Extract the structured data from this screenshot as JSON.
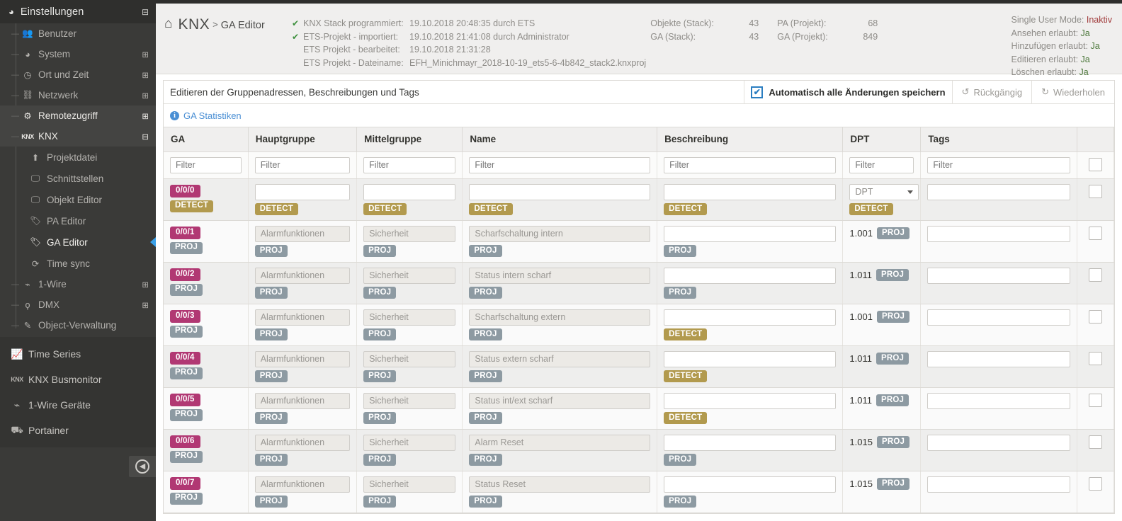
{
  "sidebar": {
    "header": {
      "title": "Einstellungen",
      "icon": "dashboard-icon",
      "collapse_icon": "minus-box-icon"
    },
    "settings_items": [
      {
        "label": "Benutzer",
        "icon": "users-icon",
        "expander": "",
        "state": "normal"
      },
      {
        "label": "System",
        "icon": "dashboard-icon",
        "expander": "plus-box-icon",
        "state": "normal"
      },
      {
        "label": "Ort und Zeit",
        "icon": "clock-icon",
        "expander": "plus-box-icon",
        "state": "normal"
      },
      {
        "label": "Netzwerk",
        "icon": "network-icon",
        "expander": "plus-box-icon",
        "state": "normal"
      },
      {
        "label": "Remotezugriff",
        "icon": "gears-icon",
        "expander": "plus-box-icon",
        "state": "active"
      },
      {
        "label": "KNX",
        "icon": "knx-icon",
        "expander": "minus-box-icon",
        "state": "active"
      }
    ],
    "knx_children": [
      {
        "label": "Projektdatei",
        "icon": "upload-icon",
        "selected": false
      },
      {
        "label": "Schnittstellen",
        "icon": "monitor-icon",
        "selected": false
      },
      {
        "label": "Objekt Editor",
        "icon": "monitor-icon",
        "selected": false
      },
      {
        "label": "PA Editor",
        "icon": "tag-icon",
        "selected": false
      },
      {
        "label": "GA Editor",
        "icon": "tag-icon",
        "selected": true
      },
      {
        "label": "Time sync",
        "icon": "refresh-icon",
        "selected": false
      }
    ],
    "settings_items_tail": [
      {
        "label": "1-Wire",
        "icon": "onewire-icon",
        "expander": "plus-box-icon",
        "state": "normal"
      },
      {
        "label": "DMX",
        "icon": "bulb-icon",
        "expander": "plus-box-icon",
        "state": "normal"
      },
      {
        "label": "Object-Verwaltung",
        "icon": "wand-icon",
        "expander": "",
        "state": "normal"
      }
    ],
    "main_items": [
      {
        "label": "Time Series",
        "icon": "chart-line-icon"
      },
      {
        "label": "KNX Busmonitor",
        "icon": "knx-icon"
      },
      {
        "label": "1-Wire Geräte",
        "icon": "onewire-icon"
      },
      {
        "label": "Portainer",
        "icon": "container-icon"
      }
    ],
    "collapse_button": {
      "icon": "arrow-left-circle-icon"
    }
  },
  "header": {
    "home_icon": "home-icon",
    "breadcrumb_root": "KNX",
    "breadcrumb_sep": ">",
    "breadcrumb_current": "GA Editor",
    "status_rows": [
      {
        "check": "✔",
        "key": "KNX Stack programmiert:",
        "value": "19.10.2018 20:48:35 durch ETS"
      },
      {
        "check": "✔",
        "key": "ETS-Projekt - importiert:",
        "value": "19.10.2018 21:41:08 durch Administrator"
      },
      {
        "check": "",
        "key": "ETS Projekt - bearbeitet:",
        "value": "19.10.2018 21:31:28"
      },
      {
        "check": "",
        "key": "ETS Projekt - Dateiname:",
        "value": "EFH_Minichmayr_2018-10-19_ets5-6-4b842_stack2.knxproj"
      }
    ],
    "counts_left": [
      {
        "key": "Objekte (Stack):",
        "value": "43"
      },
      {
        "key": "GA (Stack):",
        "value": "43"
      }
    ],
    "counts_right": [
      {
        "key": "PA (Projekt):",
        "value": "68"
      },
      {
        "key": "GA (Projekt):",
        "value": "849"
      }
    ],
    "permissions": [
      {
        "key": "Single User Mode:",
        "value": "Inaktiv",
        "state": "no"
      },
      {
        "key": "Ansehen erlaubt:",
        "value": "Ja",
        "state": "yes"
      },
      {
        "key": "Hinzufügen erlaubt:",
        "value": "Ja",
        "state": "yes"
      },
      {
        "key": "Editieren erlaubt:",
        "value": "Ja",
        "state": "yes"
      },
      {
        "key": "Löschen erlaubt:",
        "value": "Ja",
        "state": "yes"
      }
    ]
  },
  "toolbar": {
    "title": "Editieren der Gruppenadressen, Beschreibungen und Tags",
    "autosave_label": "Automatisch alle Änderungen speichern",
    "autosave_checked": true,
    "check_glyph": "✔",
    "undo_label": "Rückgängig",
    "undo_icon": "undo-icon",
    "undo_glyph": "↺",
    "redo_label": "Wiederholen",
    "redo_icon": "redo-icon",
    "redo_glyph": "↻"
  },
  "stats_link": {
    "icon": "info-icon",
    "glyph": "i",
    "label": "GA Statistiken"
  },
  "table": {
    "columns": [
      "GA",
      "Hauptgruppe",
      "Mittelgruppe",
      "Name",
      "Beschreibung",
      "DPT",
      "Tags",
      ""
    ],
    "filter_placeholder": "Filter",
    "dpt_select_placeholder": "DPT",
    "rows": [
      {
        "ga": "0/0/0",
        "ga_badge": "DETECT",
        "ga_badge_type": "detect",
        "hauptgruppe": {
          "value": "",
          "readonly": false,
          "badge": "DETECT",
          "badge_type": "detect"
        },
        "mittelgruppe": {
          "value": "",
          "readonly": false,
          "badge": "DETECT",
          "badge_type": "detect"
        },
        "name": {
          "value": "",
          "readonly": false,
          "badge": "DETECT",
          "badge_type": "detect"
        },
        "beschreibung": {
          "value": "",
          "readonly": false,
          "badge": "DETECT",
          "badge_type": "detect"
        },
        "dpt": {
          "value": "",
          "is_select": true,
          "badge": "DETECT",
          "badge_type": "detect"
        },
        "tags": {
          "value": ""
        },
        "checked": false
      },
      {
        "ga": "0/0/1",
        "ga_badge": "PROJ",
        "ga_badge_type": "proj",
        "hauptgruppe": {
          "value": "Alarmfunktionen",
          "readonly": true,
          "badge": "PROJ",
          "badge_type": "proj"
        },
        "mittelgruppe": {
          "value": "Sicherheit",
          "readonly": true,
          "badge": "PROJ",
          "badge_type": "proj"
        },
        "name": {
          "value": "Scharfschaltung intern",
          "readonly": true,
          "badge": "PROJ",
          "badge_type": "proj"
        },
        "beschreibung": {
          "value": "",
          "readonly": false,
          "badge": "PROJ",
          "badge_type": "proj"
        },
        "dpt": {
          "value": "1.001",
          "is_select": false,
          "badge": "PROJ",
          "badge_type": "proj"
        },
        "tags": {
          "value": ""
        },
        "checked": false
      },
      {
        "ga": "0/0/2",
        "ga_badge": "PROJ",
        "ga_badge_type": "proj",
        "hauptgruppe": {
          "value": "Alarmfunktionen",
          "readonly": true,
          "badge": "PROJ",
          "badge_type": "proj"
        },
        "mittelgruppe": {
          "value": "Sicherheit",
          "readonly": true,
          "badge": "PROJ",
          "badge_type": "proj"
        },
        "name": {
          "value": "Status intern scharf",
          "readonly": true,
          "badge": "PROJ",
          "badge_type": "proj"
        },
        "beschreibung": {
          "value": "",
          "readonly": false,
          "badge": "PROJ",
          "badge_type": "proj"
        },
        "dpt": {
          "value": "1.011",
          "is_select": false,
          "badge": "PROJ",
          "badge_type": "proj"
        },
        "tags": {
          "value": ""
        },
        "checked": false
      },
      {
        "ga": "0/0/3",
        "ga_badge": "PROJ",
        "ga_badge_type": "proj",
        "hauptgruppe": {
          "value": "Alarmfunktionen",
          "readonly": true,
          "badge": "PROJ",
          "badge_type": "proj"
        },
        "mittelgruppe": {
          "value": "Sicherheit",
          "readonly": true,
          "badge": "PROJ",
          "badge_type": "proj"
        },
        "name": {
          "value": "Scharfschaltung extern",
          "readonly": true,
          "badge": "PROJ",
          "badge_type": "proj"
        },
        "beschreibung": {
          "value": "",
          "readonly": false,
          "badge": "DETECT",
          "badge_type": "detect"
        },
        "dpt": {
          "value": "1.001",
          "is_select": false,
          "badge": "PROJ",
          "badge_type": "proj"
        },
        "tags": {
          "value": ""
        },
        "checked": false
      },
      {
        "ga": "0/0/4",
        "ga_badge": "PROJ",
        "ga_badge_type": "proj",
        "hauptgruppe": {
          "value": "Alarmfunktionen",
          "readonly": true,
          "badge": "PROJ",
          "badge_type": "proj"
        },
        "mittelgruppe": {
          "value": "Sicherheit",
          "readonly": true,
          "badge": "PROJ",
          "badge_type": "proj"
        },
        "name": {
          "value": "Status extern scharf",
          "readonly": true,
          "badge": "PROJ",
          "badge_type": "proj"
        },
        "beschreibung": {
          "value": "",
          "readonly": false,
          "badge": "DETECT",
          "badge_type": "detect"
        },
        "dpt": {
          "value": "1.011",
          "is_select": false,
          "badge": "PROJ",
          "badge_type": "proj"
        },
        "tags": {
          "value": ""
        },
        "checked": false
      },
      {
        "ga": "0/0/5",
        "ga_badge": "PROJ",
        "ga_badge_type": "proj",
        "hauptgruppe": {
          "value": "Alarmfunktionen",
          "readonly": true,
          "badge": "PROJ",
          "badge_type": "proj"
        },
        "mittelgruppe": {
          "value": "Sicherheit",
          "readonly": true,
          "badge": "PROJ",
          "badge_type": "proj"
        },
        "name": {
          "value": "Status int/ext scharf",
          "readonly": true,
          "badge": "PROJ",
          "badge_type": "proj"
        },
        "beschreibung": {
          "value": "",
          "readonly": false,
          "badge": "DETECT",
          "badge_type": "detect"
        },
        "dpt": {
          "value": "1.011",
          "is_select": false,
          "badge": "PROJ",
          "badge_type": "proj"
        },
        "tags": {
          "value": ""
        },
        "checked": false
      },
      {
        "ga": "0/0/6",
        "ga_badge": "PROJ",
        "ga_badge_type": "proj",
        "hauptgruppe": {
          "value": "Alarmfunktionen",
          "readonly": true,
          "badge": "PROJ",
          "badge_type": "proj"
        },
        "mittelgruppe": {
          "value": "Sicherheit",
          "readonly": true,
          "badge": "PROJ",
          "badge_type": "proj"
        },
        "name": {
          "value": "Alarm Reset",
          "readonly": true,
          "badge": "PROJ",
          "badge_type": "proj"
        },
        "beschreibung": {
          "value": "",
          "readonly": false,
          "badge": "PROJ",
          "badge_type": "proj"
        },
        "dpt": {
          "value": "1.015",
          "is_select": false,
          "badge": "PROJ",
          "badge_type": "proj"
        },
        "tags": {
          "value": ""
        },
        "checked": false
      },
      {
        "ga": "0/0/7",
        "ga_badge": "PROJ",
        "ga_badge_type": "proj",
        "hauptgruppe": {
          "value": "Alarmfunktionen",
          "readonly": true,
          "badge": "PROJ",
          "badge_type": "proj"
        },
        "mittelgruppe": {
          "value": "Sicherheit",
          "readonly": true,
          "badge": "PROJ",
          "badge_type": "proj"
        },
        "name": {
          "value": "Status Reset",
          "readonly": true,
          "badge": "PROJ",
          "badge_type": "proj"
        },
        "beschreibung": {
          "value": "",
          "readonly": false,
          "badge": "PROJ",
          "badge_type": "proj"
        },
        "dpt": {
          "value": "1.015",
          "is_select": false,
          "badge": "PROJ",
          "badge_type": "proj"
        },
        "tags": {
          "value": ""
        },
        "checked": false
      }
    ]
  },
  "colors": {
    "badge_detect": "#b29a4e",
    "badge_proj": "#8d9aa2",
    "badge_ga": "#b13873",
    "accent_link": "#4a8fd4",
    "checkbox_blue": "#2b7ec1",
    "sidebar_bg": "#3a3a38",
    "status_ok": "#3c8f3c",
    "status_no": "#a03a3a",
    "status_yes": "#4f7a3e"
  }
}
